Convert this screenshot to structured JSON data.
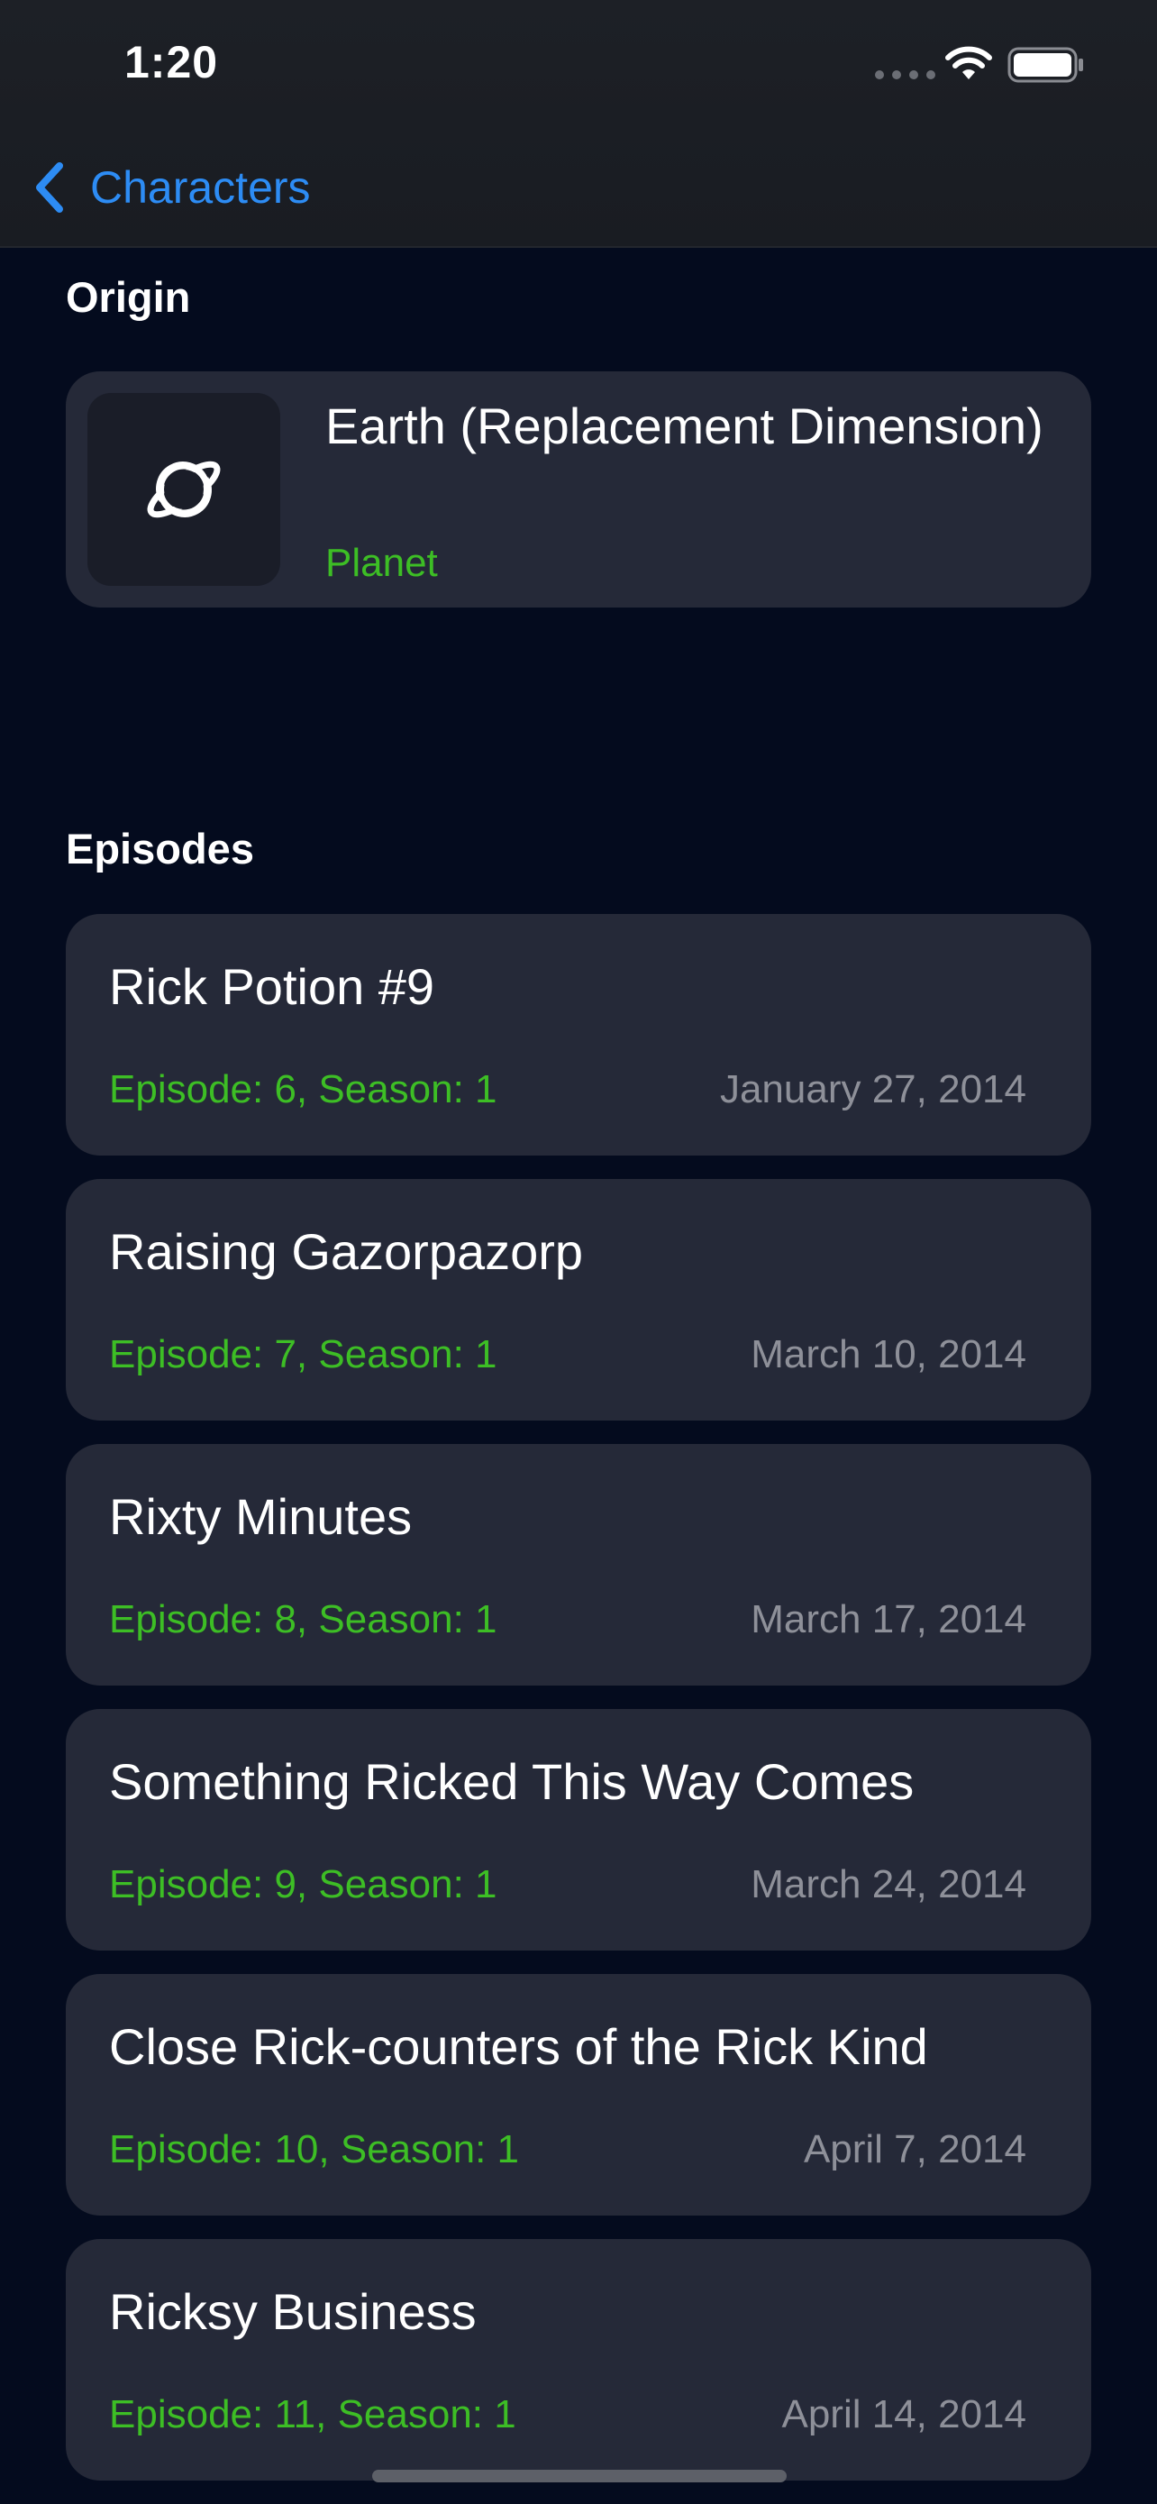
{
  "status_bar": {
    "time": "1:20"
  },
  "nav": {
    "back_label": "Characters"
  },
  "origin": {
    "section_title": "Origin",
    "name": "Earth (Replacement Dimension)",
    "type": "Planet",
    "icon": "planet-icon"
  },
  "episodes": {
    "section_title": "Episodes",
    "items": [
      {
        "name": "Rick Potion #9",
        "meta": "Episode: 6, Season: 1",
        "date": "January 27, 2014"
      },
      {
        "name": "Raising Gazorpazorp",
        "meta": "Episode: 7, Season: 1",
        "date": "March 10, 2014"
      },
      {
        "name": "Rixty Minutes",
        "meta": "Episode: 8, Season: 1",
        "date": "March 17, 2014"
      },
      {
        "name": "Something Ricked This Way Comes",
        "meta": "Episode: 9, Season: 1",
        "date": "March 24, 2014"
      },
      {
        "name": "Close Rick-counters of the Rick Kind",
        "meta": "Episode: 10, Season: 1",
        "date": "April 7, 2014"
      },
      {
        "name": "Ricksy Business",
        "meta": "Episode: 11, Season: 1",
        "date": "April 14, 2014"
      }
    ]
  },
  "colors": {
    "background": "#040B1E",
    "card": "#252938",
    "accent_green": "#3DBE25",
    "link_blue": "#2D8CF4",
    "secondary_text": "#8E9099"
  }
}
